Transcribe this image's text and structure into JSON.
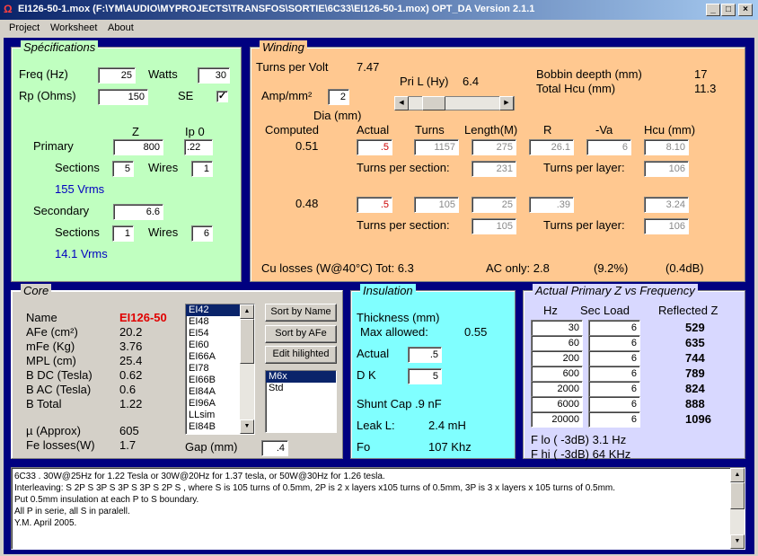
{
  "window": {
    "title": "EI126-50-1.mox  (F:\\YM\\AUDIO\\MYPROJECTS\\TRANSFOS\\SORTIE\\6C33\\EI126-50-1.mox)  OPT_DA Version 2.1.1",
    "min": "_",
    "max": "□",
    "close": "×"
  },
  "menu": [
    "Project",
    "Worksheet",
    "About"
  ],
  "spec": {
    "title": "Spécifications",
    "freq_label": "Freq (Hz)",
    "freq": "25",
    "watts_label": "Watts",
    "watts": "30",
    "rp_label": "Rp (Ohms)",
    "rp": "150",
    "se_label": "SE",
    "se_check": "✓",
    "z_label": "Z",
    "ip0_label": "Ip 0",
    "primary_label": "Primary",
    "primary_z": "800",
    "primary_ip0": ".22",
    "sections_label": "Sections",
    "wires_label": "Wires",
    "primary_sections": "5",
    "primary_wires": "1",
    "primary_vrms": "155 Vrms",
    "secondary_label": "Secondary",
    "secondary_z": "6.6",
    "secondary_sections": "1",
    "secondary_wires": "6",
    "secondary_vrms": "14.1 Vrms"
  },
  "winding": {
    "title": "Winding",
    "tpv_label": "Turns per Volt",
    "tpv": "7.47",
    "pril_label": "Pri L (Hy)",
    "pril": "6.4",
    "bobbin_label": "Bobbin deepth (mm)",
    "bobbin": "17",
    "hcu_label": "Total Hcu (mm)",
    "hcu": "11.3",
    "amp_label": "Amp/mm²",
    "amp": "2",
    "dia_label": "Dia (mm)",
    "computed_label": "Computed",
    "actual_label": "Actual",
    "turns_label": "Turns",
    "length_label": "Length(M)",
    "r_label": "R",
    "va_label": "-Va",
    "hcucol_label": "Hcu (mm)",
    "p_computed": "0.51",
    "p_actual": ".5",
    "p_turns": "1157",
    "p_length": "275",
    "p_r": "26.1",
    "p_va": "6",
    "p_hcu": "8.10",
    "tps_label": "Turns per section:",
    "tpl_label": "Turns per layer:",
    "p_tps": "231",
    "p_tpl": "106",
    "s_computed": "0.48",
    "s_actual": ".5",
    "s_turns": "105",
    "s_length": "25",
    "s_r": ".39",
    "s_hcu": "3.24",
    "s_tps": "105",
    "s_tpl": "106",
    "culoss": "Cu losses (W@40°C) Tot:   6.3",
    "aconly": "AC only:  2.8",
    "pct": "(9.2%)",
    "db": "(0.4dB)"
  },
  "core": {
    "title": "Core",
    "name_label": "Name",
    "name": "EI126-50",
    "afe_label": "AFe (cm²)",
    "afe": "20.2",
    "mfe_label": "mFe (Kg)",
    "mfe": "3.76",
    "mpl_label": "MPL (cm)",
    "mpl": "25.4",
    "bdc_label": "B DC (Tesla)",
    "bdc": "0.62",
    "bac_label": "B AC (Tesla)",
    "bac": "0.6",
    "btot_label": "B Total",
    "btot": "1.22",
    "mu_label": "µ (Approx)",
    "mu": "605",
    "fel_label": "Fe losses(W)",
    "fel": "1.7",
    "list": [
      "EI42",
      "EI48",
      "EI54",
      "EI60",
      "EI66A",
      "EI78",
      "EI66B",
      "EI84A",
      "EI96A",
      "LLsim",
      "EI84B"
    ],
    "sort_name": "Sort by Name",
    "sort_afe": "Sort by AFe",
    "edit": "Edit hilighted",
    "list2": [
      "M6x",
      "Std"
    ],
    "gap_label": "Gap (mm)",
    "gap": ".4"
  },
  "insul": {
    "title": "Insulation",
    "thick_label": "Thickness (mm)",
    "maxallow_label": "Max allowed:",
    "maxallow": "0.55",
    "actual_label": "Actual",
    "actual": ".5",
    "dk_label": "D K",
    "dk": "5",
    "shunt": "Shunt Cap  .9 nF",
    "leak_label": "Leak L:",
    "leak": "2.4 mH",
    "fo_label": "Fo",
    "fo": "107 Khz"
  },
  "zfreq": {
    "title": "Actual Primary Z vs Frequency",
    "hz_label": "Hz",
    "sec_label": "Sec Load",
    "ref_label": "Reflected Z",
    "rows": [
      {
        "hz": "30",
        "sec": "6",
        "ref": "529"
      },
      {
        "hz": "60",
        "sec": "6",
        "ref": "635"
      },
      {
        "hz": "200",
        "sec": "6",
        "ref": "744"
      },
      {
        "hz": "600",
        "sec": "6",
        "ref": "789"
      },
      {
        "hz": "2000",
        "sec": "6",
        "ref": "824"
      },
      {
        "hz": "6000",
        "sec": "6",
        "ref": "888"
      },
      {
        "hz": "20000",
        "sec": "6",
        "ref": "1096"
      }
    ],
    "flo": "F lo ( -3dB) 3.1 Hz",
    "fhi": "F hi ( -3dB)    64 KHz"
  },
  "notes": [
    "6C33 . 30W@25Hz for 1.22 Tesla or 30W@20Hz for 1.37 tesla, or 50W@30Hz for 1.26 tesla.",
    "Interleaving: S 2P S 3P S 3P S 3P S 2P S , where S is 105 turns of 0.5mm, 2P is 2 x layers x105 turns of 0.5mm, 3P is 3 x layers x 105 turns of 0.5mm.",
    "Put 0.5mm insulation at each P to S boundary.",
    "All P in serie, all S in paralell.",
    "Y.M. April 2005."
  ]
}
